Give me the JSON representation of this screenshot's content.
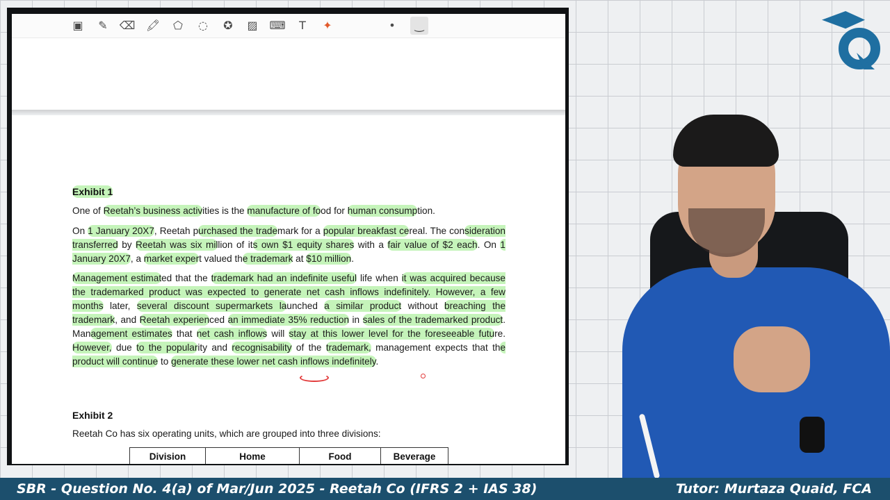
{
  "toolbar": {
    "tools": [
      {
        "name": "image-edit-tool",
        "glyph": "▣"
      },
      {
        "name": "pen-tool",
        "glyph": "✎"
      },
      {
        "name": "eraser-tool",
        "glyph": "⌫"
      },
      {
        "name": "highlighter-tool",
        "glyph": "🖍"
      },
      {
        "name": "shapes-tool",
        "glyph": "⬠"
      },
      {
        "name": "lasso-tool",
        "glyph": "◌"
      },
      {
        "name": "sticker-tool",
        "glyph": "✪"
      },
      {
        "name": "image-tool",
        "glyph": "▨"
      },
      {
        "name": "keyboard-tool",
        "glyph": "⌨"
      },
      {
        "name": "text-tool",
        "glyph": "T"
      },
      {
        "name": "laser-pointer-tool",
        "glyph": "✦"
      },
      {
        "name": "pen-size-small",
        "glyph": "•"
      },
      {
        "name": "pen-stroke-style",
        "glyph": "‿"
      }
    ]
  },
  "document": {
    "exhibit1_heading": "Exhibit 1",
    "para1": [
      {
        "t": "One of "
      },
      {
        "t": "Reetah’s business activ",
        "hl": true
      },
      {
        "t": "ities is the "
      },
      {
        "t": "manufacture of fo",
        "hl": true
      },
      {
        "t": "od for "
      },
      {
        "t": "human consump",
        "hl": true
      },
      {
        "t": "tion."
      }
    ],
    "para2": [
      {
        "t": "On "
      },
      {
        "t": "1 January 20X7",
        "hl": true
      },
      {
        "t": ", Reetah p"
      },
      {
        "t": "urchased the trade",
        "hl": true
      },
      {
        "t": "mark for a "
      },
      {
        "t": "popular breakfast ce",
        "hl": true
      },
      {
        "t": "real. The con"
      },
      {
        "t": "sideration transferred",
        "hl": true
      },
      {
        "t": " by "
      },
      {
        "t": "Reetah was six mil",
        "hl": true
      },
      {
        "t": "lion of it"
      },
      {
        "t": "s own $1 equity shares",
        "hl": true
      },
      {
        "t": " with a "
      },
      {
        "t": "fair value of $2 each",
        "hl": true
      },
      {
        "t": ". On "
      },
      {
        "t": "1 January 20X7",
        "hl": true
      },
      {
        "t": ", a "
      },
      {
        "t": "market exper",
        "hl": true
      },
      {
        "t": "t valued th"
      },
      {
        "t": "e trademark",
        "hl": true
      },
      {
        "t": " at "
      },
      {
        "t": "$10 million",
        "hl": true
      },
      {
        "t": "."
      }
    ],
    "para3": [
      {
        "t": "Management estimat",
        "hl": true
      },
      {
        "t": "ed that the "
      },
      {
        "t": "trademark had an indefinite useful",
        "hl": true
      },
      {
        "t": " life when "
      },
      {
        "t": "it was acquired because the trademarked product was expected to generate net cash inflows indefinitely. However, a few months",
        "hl": true
      },
      {
        "t": " later, "
      },
      {
        "t": "several discount supermarkets la",
        "hl": true
      },
      {
        "t": "unched "
      },
      {
        "t": "a similar product",
        "hl": true
      },
      {
        "t": " without "
      },
      {
        "t": "breaching the trademark",
        "hl": true
      },
      {
        "t": ", and "
      },
      {
        "t": "Reetah experien",
        "hl": true
      },
      {
        "t": "ced "
      },
      {
        "t": "an immediate 35% reduction",
        "hl": true
      },
      {
        "t": " in "
      },
      {
        "t": "sales of the trademarked product",
        "hl": true
      },
      {
        "t": ". Man"
      },
      {
        "t": "agement estimates",
        "hl": true
      },
      {
        "t": " that "
      },
      {
        "t": "net cash inflows",
        "hl": true
      },
      {
        "t": " will "
      },
      {
        "t": "stay at this lower level for the foreseeable futu",
        "hl": true
      },
      {
        "t": "re. "
      },
      {
        "t": "However,",
        "hl": true
      },
      {
        "t": " due "
      },
      {
        "t": "to the popular",
        "hl": true
      },
      {
        "t": "ity and "
      },
      {
        "t": "recognisability",
        "hl": true
      },
      {
        "t": " of the "
      },
      {
        "t": "trademark,",
        "hl": true
      },
      {
        "t": " management expects that th"
      },
      {
        "t": "e product will continue",
        "hl": true
      },
      {
        "t": " to "
      },
      {
        "t": "generate these lower net cash inflows indefinitely",
        "hl": true
      },
      {
        "t": "."
      }
    ],
    "exhibit2_heading": "Exhibit 2",
    "para4": "Reetah Co has six operating units, which are grouped into three divisions:",
    "table_headers": [
      "Division",
      "Home",
      "Food",
      "Beverage"
    ]
  },
  "caption": {
    "left": "SBR - Question No. 4(a) of Mar/Jun 2025 - Reetah Co (IFRS 2 + IAS 38)",
    "right": "Tutor: Murtaza Quaid, FCA"
  },
  "colors": {
    "highlight": "#96eb82",
    "caption_bar": "#1c4f6d",
    "logo": "#1f6fa1",
    "annotation_red": "#e23a3a"
  }
}
